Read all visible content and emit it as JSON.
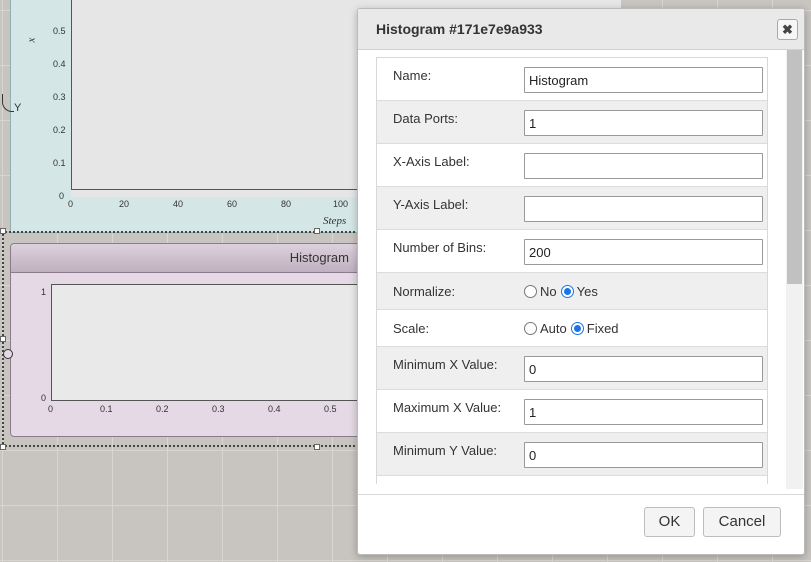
{
  "canvas": {
    "top_plot": {
      "y_axis_title": "x",
      "y_ticks": [
        "0.5",
        "0.4",
        "0.3",
        "0.2",
        "0.1",
        "0"
      ],
      "x_ticks": [
        "0",
        "20",
        "40",
        "60",
        "80",
        "100"
      ],
      "x_axis_title": "Steps",
      "port_label": "Y"
    },
    "histogram_block": {
      "title": "Histogram",
      "y_ticks": [
        "1",
        "0"
      ],
      "x_ticks": [
        "0",
        "0.1",
        "0.2",
        "0.3",
        "0.4",
        "0.5"
      ]
    }
  },
  "dialog": {
    "title": "Histogram #171e7e9a933",
    "close_icon": "close-icon",
    "fields": {
      "name": {
        "label": "Name:",
        "value": "Histogram"
      },
      "data_ports": {
        "label": "Data Ports:",
        "value": "1"
      },
      "x_axis_label": {
        "label": "X-Axis Label:",
        "value": ""
      },
      "y_axis_label": {
        "label": "Y-Axis Label:",
        "value": ""
      },
      "number_of_bins": {
        "label": "Number of Bins:",
        "value": "200"
      },
      "normalize": {
        "label": "Normalize:",
        "options": [
          "No",
          "Yes"
        ],
        "selected": "Yes"
      },
      "scale": {
        "label": "Scale:",
        "options": [
          "Auto",
          "Fixed"
        ],
        "selected": "Fixed"
      },
      "min_x": {
        "label": "Minimum X Value:",
        "value": "0"
      },
      "max_x": {
        "label": "Maximum X Value:",
        "value": "1"
      },
      "min_y": {
        "label": "Minimum Y Value:",
        "value": "0"
      }
    },
    "ok_label": "OK",
    "cancel_label": "Cancel"
  }
}
